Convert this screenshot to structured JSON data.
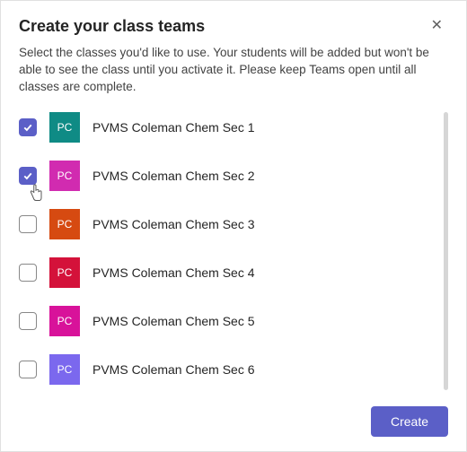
{
  "dialog": {
    "title": "Create your class teams",
    "subtitle": "Select the classes you'd like to use. Your students will be added but won't be able to see the class until you activate it. Please keep Teams open until all classes are complete.",
    "close_label": "✕"
  },
  "classes": [
    {
      "label": "PVMS Coleman Chem Sec 1",
      "initials": "PC",
      "color": "#0f8b85",
      "checked": true,
      "cursor": false
    },
    {
      "label": "PVMS Coleman Chem Sec 2",
      "initials": "PC",
      "color": "#d12bb0",
      "checked": true,
      "cursor": true
    },
    {
      "label": "PVMS Coleman Chem Sec 3",
      "initials": "PC",
      "color": "#d64a11",
      "checked": false,
      "cursor": false
    },
    {
      "label": "PVMS Coleman Chem Sec 4",
      "initials": "PC",
      "color": "#d4123a",
      "checked": false,
      "cursor": false
    },
    {
      "label": "PVMS Coleman Chem Sec 5",
      "initials": "PC",
      "color": "#d8129a",
      "checked": false,
      "cursor": false
    },
    {
      "label": "PVMS Coleman Chem Sec 6",
      "initials": "PC",
      "color": "#7b68ee",
      "checked": false,
      "cursor": false
    }
  ],
  "footer": {
    "create_label": "Create"
  }
}
